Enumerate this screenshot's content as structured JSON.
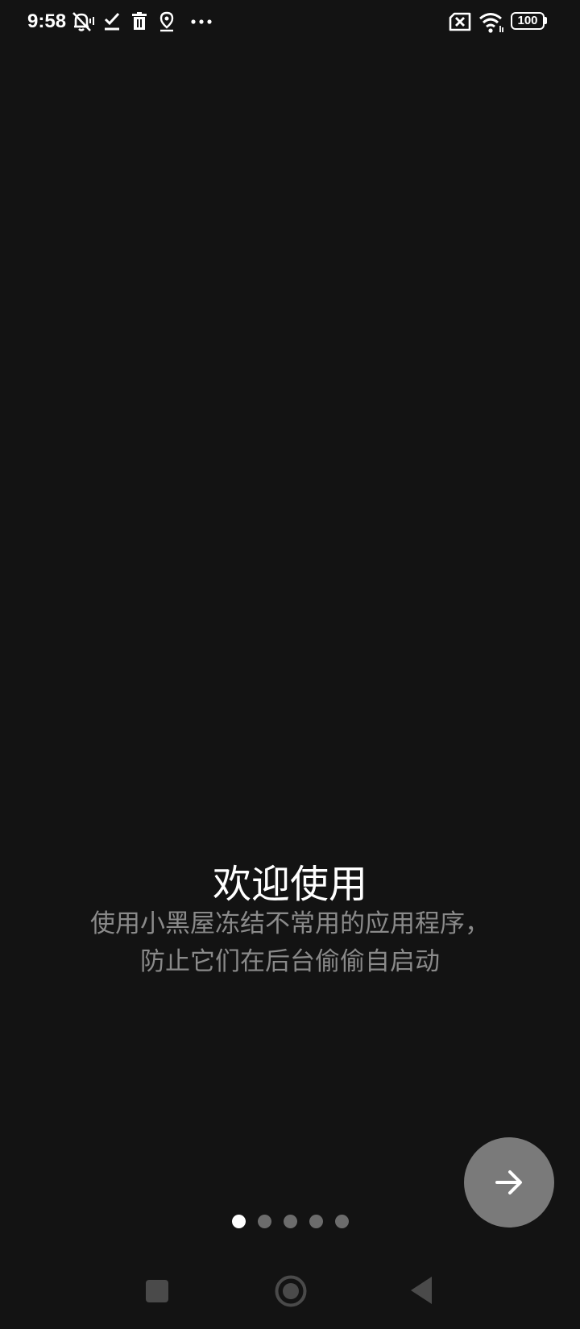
{
  "status_bar": {
    "time": "9:58",
    "left_icons": [
      "bell-muted-icon",
      "download-done-icon",
      "trash-icon",
      "location-pin-icon",
      "more-dots-icon"
    ],
    "right_icons": [
      "sim-error-icon",
      "wifi-icon",
      "battery-icon"
    ],
    "battery": "100"
  },
  "onboarding": {
    "title": "欢迎使用",
    "description_line1": "使用小黑屋冻结不常用的应用程序，",
    "description_line2": "防止它们在后台偷偷自启动",
    "page_count": 5,
    "current_page": 1,
    "next_icon": "arrow-right-icon"
  },
  "nav_bar": {
    "buttons": [
      "recents-square-icon",
      "home-circle-icon",
      "back-triangle-icon"
    ]
  },
  "colors": {
    "background": "#131313",
    "title": "#ffffff",
    "description": "#8a8a8a",
    "next_button": "#7a7a7a",
    "dot_active": "#ffffff",
    "dot_inactive": "#6c6c6c"
  }
}
